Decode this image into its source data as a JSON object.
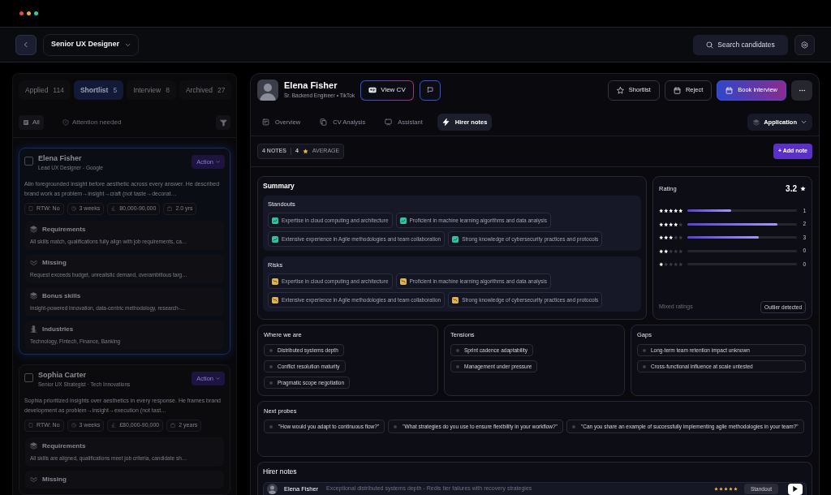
{
  "header": {
    "job": "Senior UX Designer",
    "search": "Search candidates"
  },
  "pipeline": {
    "tabs": [
      {
        "label": "Applied",
        "count": "114",
        "selected": false
      },
      {
        "label": "Shortlist",
        "count": "5",
        "selected": true
      },
      {
        "label": "Interview",
        "count": "8",
        "selected": false
      },
      {
        "label": "Archived",
        "count": "27",
        "selected": false
      }
    ],
    "filters": [
      {
        "kind": "all",
        "label": "All",
        "selected": true
      },
      {
        "kind": "attention",
        "label": "Attention needed",
        "selected": false
      }
    ],
    "candidates": [
      {
        "name": "Elena Fisher",
        "role": "Lead UX Designer - Google",
        "checked": false,
        "selected": true,
        "action": "Action",
        "summary": "Alin foregrounded insight before aesthetic across every answer. He described brand work as problem→insight→craft (not taste→decorat…",
        "facts": [
          {
            "kind": "rtw",
            "label": "RTW: No"
          },
          {
            "kind": "notice",
            "label": "3 weeks"
          },
          {
            "kind": "salary",
            "label": "80,000-90,000"
          },
          {
            "kind": "experience",
            "label": "2.0 yrs"
          }
        ],
        "sections": [
          {
            "kind": "requirements",
            "title": "Requirements",
            "text": "All skills match, qualifications fully align with job requirements, ca…"
          },
          {
            "kind": "missing",
            "title": "Missing",
            "text": "Request exceeds budget, unrealistic demand, overambitious targ…"
          },
          {
            "kind": "bonus",
            "title": "Bonus skills",
            "text": "Insight-powered innovation, data-centric methodology, research-…"
          },
          {
            "kind": "industries",
            "title": "Industries",
            "text": "Technology, Fintech, Finance, Banking"
          }
        ]
      },
      {
        "name": "Sophia Carter",
        "role": "Senior UX Strategist · Tech Innovations",
        "checked": false,
        "selected": false,
        "action": "Action",
        "summary": "Sophia prioritized insights over aesthetics in every response. He frames brand development as problem→insight→execution (not tast…",
        "facts": [
          {
            "kind": "rtw",
            "label": "RTW: No"
          },
          {
            "kind": "notice",
            "label": "3 weeks"
          },
          {
            "kind": "salary",
            "label": "£80,000-90,000"
          },
          {
            "kind": "experience",
            "label": "2 years"
          }
        ],
        "sections": [
          {
            "kind": "requirements",
            "title": "Requirements",
            "text": "All skills are aligned, qualifications meet job criteria, candidate sh…"
          },
          {
            "kind": "missing",
            "title": "Missing"
          }
        ]
      }
    ]
  },
  "candidate": {
    "name": "Elena Fisher",
    "role": "Sr. Backend Engineer • TikTok",
    "view_cv": "View CV",
    "actions": [
      {
        "kind": "shortlist",
        "label": "Shortlist"
      },
      {
        "kind": "reject",
        "label": "Reject"
      },
      {
        "kind": "book",
        "label": "Book interview"
      }
    ],
    "tabs": [
      {
        "kind": "overview",
        "label": "Overview",
        "selected": false
      },
      {
        "kind": "analysis",
        "label": "CV Analysis",
        "selected": false
      },
      {
        "kind": "assistant",
        "label": "Assistant",
        "selected": false
      },
      {
        "kind": "notes",
        "label": "Hirer notes",
        "selected": true
      }
    ],
    "stage": "Application"
  },
  "notes_bar": {
    "count": "4 NOTES",
    "average": "4",
    "average_label": "AVERAGE",
    "add": "+ Add note"
  },
  "summary": {
    "title": "Summary",
    "groups": [
      {
        "kind": "standout",
        "title": "Standouts",
        "items": [
          "Expertise in cloud computing and architecture",
          "Proficient in machine learning algorithms and data analysis",
          "Extensive experience in Agile methodologies and team collaboration",
          "Strong knowledge of cybersecurity practices and protocols"
        ]
      },
      {
        "kind": "risk",
        "title": "Risks",
        "items": [
          "Expertise in cloud computing and architecture",
          "Proficient in machine learning algorithms and data analysis",
          "Extensive experience in Agile methodologies and team collaboration",
          "Strong knowledge of cybersecurity practices and protocols"
        ]
      }
    ]
  },
  "rating": {
    "title": "Rating",
    "score": "3.2",
    "rows": [
      {
        "stars": 5,
        "level": 0.4,
        "count": "1"
      },
      {
        "stars": 4,
        "level": 0.82,
        "count": "2"
      },
      {
        "stars": 3,
        "level": 0.65,
        "count": "3"
      },
      {
        "stars": 2,
        "level": 0,
        "count": "0"
      },
      {
        "stars": 1,
        "level": 0,
        "count": "0"
      }
    ],
    "note": "Mixed ratings",
    "badge": "Outlier detected"
  },
  "insights": [
    {
      "title": "Where we are",
      "items": [
        "Distributed systems depth",
        "Conflict resolution maturity",
        "Pragmatic scope negotiation"
      ]
    },
    {
      "title": "Tensions",
      "items": [
        "Sprint cadence adaptability",
        "Management under pressure"
      ]
    },
    {
      "title": "Gaps",
      "items": [
        "Long-term team retention impact unknown",
        "Cross-functional influence at scale untested"
      ]
    }
  ],
  "next_probes": {
    "title": "Next probes",
    "items": [
      "\"How would you adapt to continuous flow?\"",
      "\"What strategies do you use to ensure flexibility in your workflow?\"",
      "\"Can you share an example of successfully implementing agile methodologies in your team?\""
    ]
  },
  "hirer_notes": {
    "title": "Hirer notes",
    "notes": [
      {
        "author": "Elena Fisher",
        "text": "Exceptional distributed systems depth - Redis tier failures with recovery strategies",
        "stars": 5,
        "tag": "Standout"
      }
    ]
  }
}
